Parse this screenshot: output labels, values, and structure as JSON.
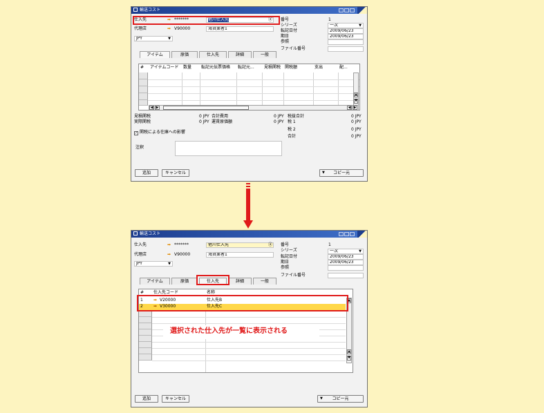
{
  "window_title": "輸送コスト",
  "header": {
    "vendor_label": "仕入先",
    "vendor_code": "*******",
    "vendor_name_top": "他川仕入先",
    "vendor_name_bottom": "他川仕入先",
    "agent_label": "代理店",
    "agent_code": "V90000",
    "agent_name": "海貨業者1",
    "currency": "JPY",
    "number_label": "番号",
    "number_value": "1",
    "series_label": "シリーズ",
    "series_value": "一次",
    "posting_label": "転記日付",
    "posting_value": "2009/06/23",
    "due_label": "期日",
    "due_value": "2009/06/23",
    "reference_label": "参照",
    "file_label": "ファイル番号"
  },
  "tabs": [
    "アイテム",
    "原価",
    "仕入先",
    "詳細",
    "一般"
  ],
  "item_grid": {
    "columns": [
      "#",
      "アイテムコード",
      "数量",
      "転記元伝票価格",
      "転記元...",
      "見積関税",
      "関税額",
      "支出",
      "配..."
    ]
  },
  "totals": {
    "est_customs_label": "見積関税",
    "est_customs_value": "0 JPY",
    "actual_customs_label": "実際関税",
    "actual_customs_value": "0 JPY",
    "total_expense_label": "合計費用",
    "total_expense_value": "0 JPY",
    "total_fc_label": "運賃原価額",
    "total_fc_value": "0 JPY",
    "before_tax_label": "税抜合計",
    "before_tax_value": "0 JPY",
    "tax1_label": "税 1",
    "tax1_value": "0 JPY",
    "tax2_label": "税 2",
    "tax2_value": "0 JPY",
    "total_label": "合計",
    "total_value": "0 JPY",
    "checkbox_label": "関税による在庫への影響",
    "remarks_label": "注釈"
  },
  "buttons": {
    "add": "追加",
    "cancel": "キャンセル",
    "copy_from": "コピー元"
  },
  "vendor_grid": {
    "columns": [
      "#",
      "仕入先コード",
      "名称"
    ],
    "rows": [
      {
        "num": "1",
        "code": "V20000",
        "name": "仕入先B"
      },
      {
        "num": "2",
        "code": "V30000",
        "name": "仕入先C"
      }
    ]
  },
  "callout": "選択された仕入先が一覧に表示される",
  "colors": {
    "highlight": "#e01a1a",
    "title_bar": "#1d3e8f",
    "background": "#fdf4c0"
  }
}
